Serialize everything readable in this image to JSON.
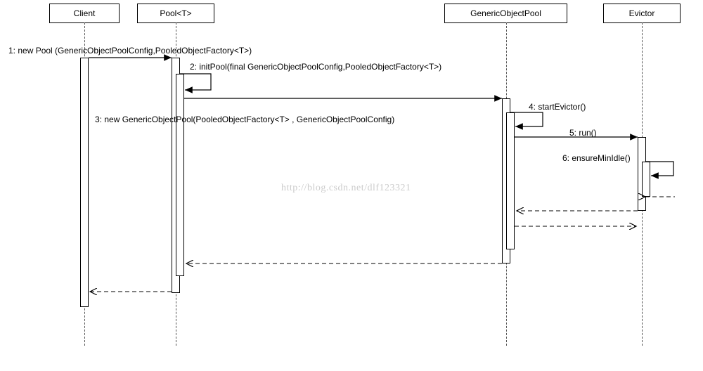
{
  "participants": {
    "client": "Client",
    "pool": "Pool<T>",
    "gop": "GenericObjectPool",
    "evictor": "Evictor"
  },
  "messages": {
    "m1": "1: new Pool (GenericObjectPoolConfig,PooledObjectFactory<T>)",
    "m2": "2: initPool(final GenericObjectPoolConfig,PooledObjectFactory<T>)",
    "m3": "3: new GenericObjectPool(PooledObjectFactory<T> ,  GenericObjectPoolConfig)",
    "m4": "4: startEvictor()",
    "m5": "5: run()",
    "m6": "6: ensureMinIdle()"
  },
  "watermark": "http://blog.csdn.net/dlf123321",
  "chart_data": {
    "type": "sequence-diagram",
    "participants": [
      "Client",
      "Pool<T>",
      "GenericObjectPool",
      "Evictor"
    ],
    "interactions": [
      {
        "seq": 1,
        "from": "Client",
        "to": "Pool<T>",
        "kind": "call",
        "label": "new Pool (GenericObjectPoolConfig,PooledObjectFactory<T>)"
      },
      {
        "seq": 2,
        "from": "Pool<T>",
        "to": "Pool<T>",
        "kind": "self",
        "label": "initPool(final GenericObjectPoolConfig,PooledObjectFactory<T>)"
      },
      {
        "seq": 3,
        "from": "Pool<T>",
        "to": "GenericObjectPool",
        "kind": "call",
        "label": "new GenericObjectPool(PooledObjectFactory<T> ,  GenericObjectPoolConfig)"
      },
      {
        "seq": 4,
        "from": "GenericObjectPool",
        "to": "GenericObjectPool",
        "kind": "self",
        "label": "startEvictor()"
      },
      {
        "seq": 5,
        "from": "GenericObjectPool",
        "to": "Evictor",
        "kind": "call",
        "label": "run()"
      },
      {
        "seq": 6,
        "from": "Evictor",
        "to": "Evictor",
        "kind": "self",
        "label": "ensureMinIdle()"
      },
      {
        "from": "Evictor",
        "to": "GenericObjectPool",
        "kind": "return"
      },
      {
        "from": "GenericObjectPool",
        "to": "Evictor",
        "kind": "return"
      },
      {
        "from": "GenericObjectPool",
        "to": "Pool<T>",
        "kind": "return"
      },
      {
        "from": "Pool<T>",
        "to": "Client",
        "kind": "return"
      }
    ]
  }
}
